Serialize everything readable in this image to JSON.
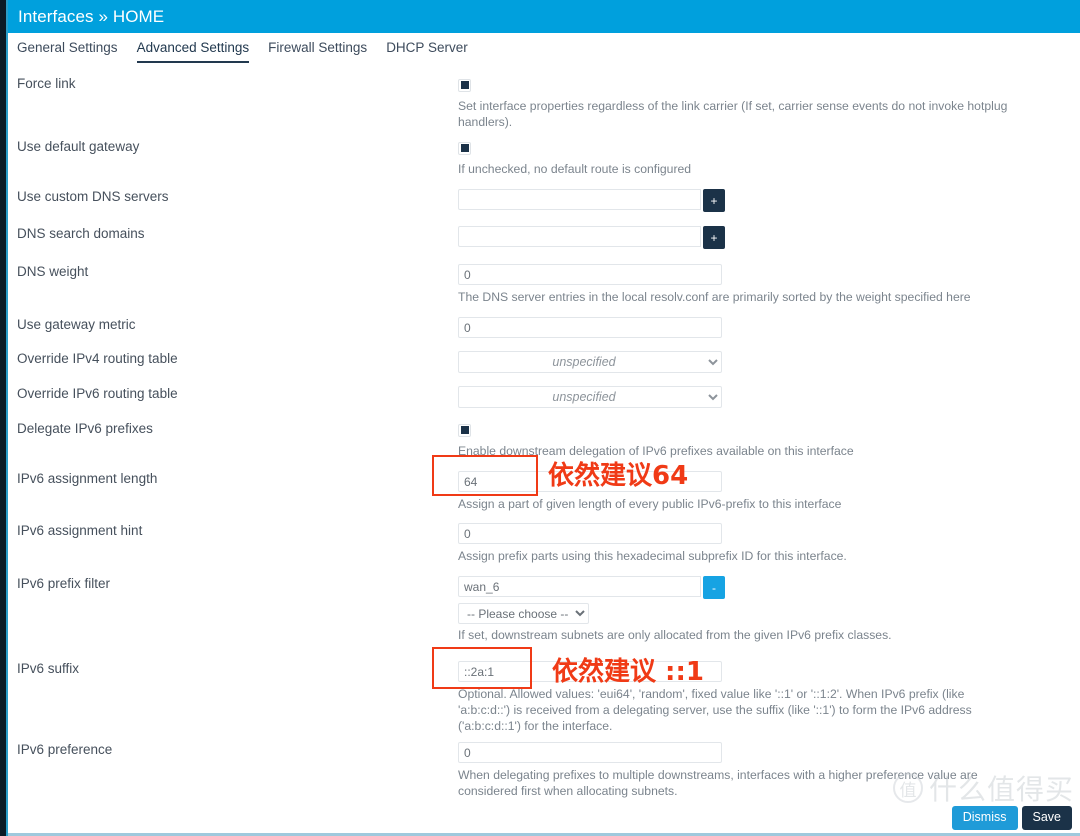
{
  "header": {
    "title": "Interfaces » HOME",
    "accent": "#00a0dd"
  },
  "tabs": [
    {
      "label": "General Settings",
      "active": false
    },
    {
      "label": "Advanced Settings",
      "active": true
    },
    {
      "label": "Firewall Settings",
      "active": false
    },
    {
      "label": "DHCP Server",
      "active": false
    }
  ],
  "rows": {
    "force_link": {
      "label": "Force link",
      "checked": true,
      "help": "Set interface properties regardless of the link carrier (If set, carrier sense events do not invoke hotplug handlers)."
    },
    "default_gateway": {
      "label": "Use default gateway",
      "checked": true,
      "help": "If unchecked, no default route is configured"
    },
    "custom_dns": {
      "label": "Use custom DNS servers",
      "value": "",
      "add_label": "+"
    },
    "dns_search": {
      "label": "DNS search domains",
      "value": "",
      "add_label": "+"
    },
    "dns_weight": {
      "label": "DNS weight",
      "value": "0",
      "help": "The DNS server entries in the local resolv.conf are primarily sorted by the weight specified here"
    },
    "gateway_metric": {
      "label": "Use gateway metric",
      "value": "0"
    },
    "override_ipv4": {
      "label": "Override IPv4 routing table",
      "selected": "unspecified"
    },
    "override_ipv6": {
      "label": "Override IPv6 routing table",
      "selected": "unspecified"
    },
    "delegate_ipv6": {
      "label": "Delegate IPv6 prefixes",
      "checked": true,
      "help": "Enable downstream delegation of IPv6 prefixes available on this interface"
    },
    "assignment_length": {
      "label": "IPv6 assignment length",
      "value": "64",
      "help": "Assign a part of given length of every public IPv6-prefix to this interface"
    },
    "assignment_hint": {
      "label": "IPv6 assignment hint",
      "value": "0",
      "help": "Assign prefix parts using this hexadecimal subprefix ID for this interface."
    },
    "prefix_filter": {
      "label": "IPv6 prefix filter",
      "value": "wan_6",
      "remove_label": "-",
      "choose_placeholder": "-- Please choose --",
      "help": "If set, downstream subnets are only allocated from the given IPv6 prefix classes."
    },
    "suffix": {
      "label": "IPv6 suffix",
      "value": "::2a:1",
      "help": "Optional. Allowed values: 'eui64', 'random', fixed value like '::1' or '::1:2'. When IPv6 prefix (like 'a:b:c:d::') is received from a delegating server, use the suffix (like '::1') to form the IPv6 address ('a:b:c:d::1') for the interface."
    },
    "preference": {
      "label": "IPv6 preference",
      "value": "0",
      "help": "When delegating prefixes to multiple downstreams, interfaces with a higher preference value are considered first when allocating subnets."
    }
  },
  "annotations": {
    "color": "#f03a16",
    "length_note": "依然建议64",
    "suffix_note": "依然建议 ::1"
  },
  "watermark": {
    "logo_char": "值",
    "text": "什么值得买"
  },
  "actions": {
    "dismiss_label": "Dismiss",
    "save_label": "Save"
  }
}
